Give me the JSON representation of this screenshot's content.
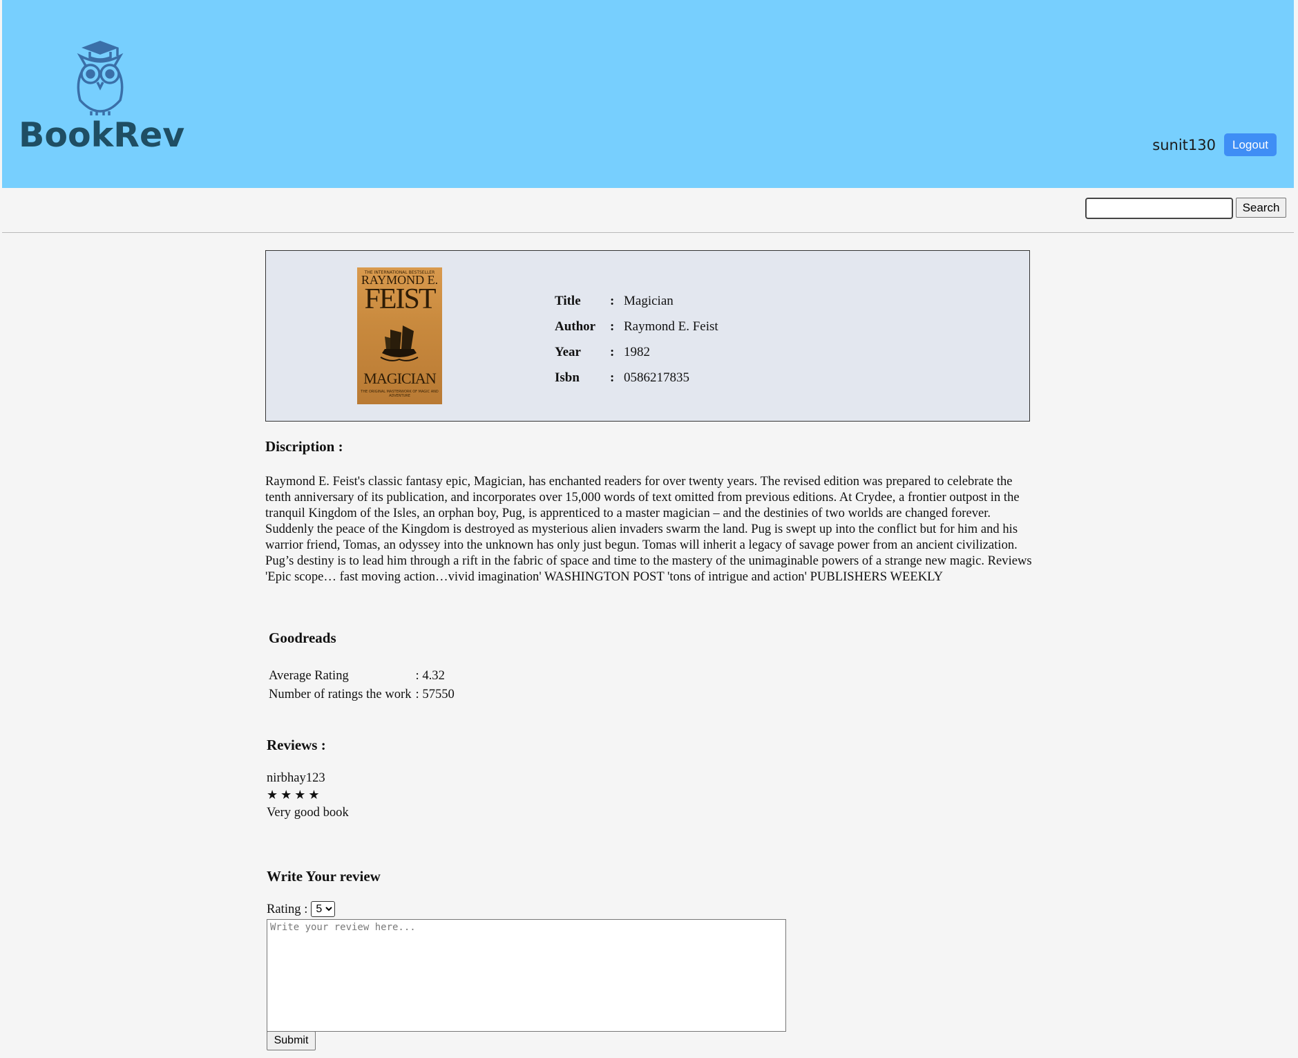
{
  "header": {
    "logo_text": "BookRev",
    "username": "sunit130",
    "logout_label": "Logout"
  },
  "search": {
    "value": "",
    "button_label": "Search"
  },
  "book": {
    "cover": {
      "tagline": "THE INTERNATIONAL BESTSELLER",
      "author_line1": "RAYMOND E.",
      "author_line2": "FEIST",
      "title": "MAGICIAN",
      "subtitle": "THE ORIGINAL MASTERWORK OF MAGIC AND ADVENTURE"
    },
    "fields": [
      {
        "label": "Title",
        "sep": ":",
        "value": "Magician"
      },
      {
        "label": "Author",
        "sep": ":",
        "value": "Raymond E. Feist"
      },
      {
        "label": "Year",
        "sep": ":",
        "value": "1982"
      },
      {
        "label": "Isbn",
        "sep": ":",
        "value": "0586217835"
      }
    ]
  },
  "description": {
    "heading": "Discription :",
    "text": "Raymond E. Feist's classic fantasy epic, Magician, has enchanted readers for over twenty years. The revised edition was prepared to celebrate the tenth anniversary of its publication, and incorporates over 15,000 words of text omitted from previous editions. At Crydee, a frontier outpost in the tranquil Kingdom of the Isles, an orphan boy, Pug, is apprenticed to a master magician – and the destinies of two worlds are changed forever. Suddenly the peace of the Kingdom is destroyed as mysterious alien invaders swarm the land. Pug is swept up into the conflict but for him and his warrior friend, Tomas, an odyssey into the unknown has only just begun. Tomas will inherit a legacy of savage power from an ancient civilization. Pug’s destiny is to lead him through a rift in the fabric of space and time to the mastery of the unimaginable powers of a strange new magic. Reviews 'Epic scope… fast moving action…vivid imagination' WASHINGTON POST 'tons of intrigue and action' PUBLISHERS WEEKLY"
  },
  "goodreads": {
    "heading": "Goodreads",
    "rows": [
      {
        "label": "Average Rating",
        "value": ": 4.32"
      },
      {
        "label": "Number of ratings the work",
        "value": ": 57550"
      }
    ]
  },
  "reviews": {
    "heading": "Reviews :",
    "items": [
      {
        "user": "nirbhay123",
        "stars": "★★★★",
        "rating": 4,
        "text": "Very good book"
      }
    ]
  },
  "write_review": {
    "heading": "Write Your review",
    "rating_label": "Rating :",
    "rating_value": "5",
    "placeholder": "Write your review here...",
    "submit_label": "Submit"
  },
  "colors": {
    "header_bg": "#77cffe",
    "logout_bg": "#3f8ef5",
    "logo_text": "#1f4e63",
    "book_box_bg": "#e3e7ef"
  }
}
